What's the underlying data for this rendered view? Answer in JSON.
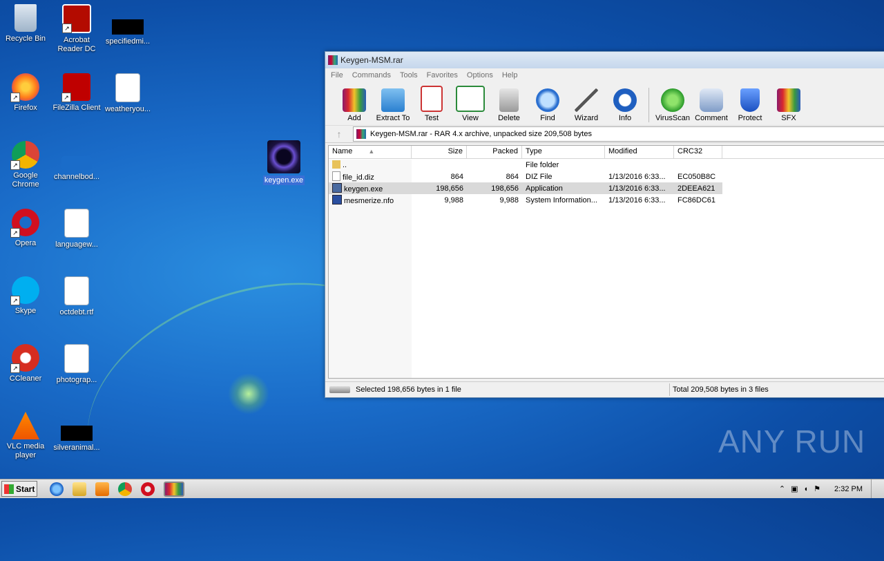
{
  "desktop": {
    "icons": [
      {
        "label": "Recycle Bin",
        "icon": "recycle-bin-icon"
      },
      {
        "label": "Acrobat Reader DC",
        "icon": "acrobat-icon"
      },
      {
        "label": "specifiedmi...",
        "icon": "blacked-file-icon"
      },
      {
        "label": "Firefox",
        "icon": "firefox-icon"
      },
      {
        "label": "FileZilla Client",
        "icon": "filezilla-icon"
      },
      {
        "label": "weatheryou...",
        "icon": "word-doc-icon"
      },
      {
        "label": "Google Chrome",
        "icon": "chrome-icon"
      },
      {
        "label": "channelbod...",
        "icon": "blank-file-icon"
      },
      {
        "label": "Opera",
        "icon": "opera-icon"
      },
      {
        "label": "languagew...",
        "icon": "word-doc-icon"
      },
      {
        "label": "Skype",
        "icon": "skype-icon"
      },
      {
        "label": "octdebt.rtf",
        "icon": "word-doc-icon"
      },
      {
        "label": "CCleaner",
        "icon": "ccleaner-icon"
      },
      {
        "label": "photograp...",
        "icon": "word-doc-icon"
      },
      {
        "label": "VLC media player",
        "icon": "vlc-icon"
      },
      {
        "label": "silveranimal...",
        "icon": "blacked-file-icon"
      }
    ],
    "selected_icon": {
      "label": "keygen.exe"
    }
  },
  "window": {
    "title": "Keygen-MSM.rar",
    "menu": [
      "File",
      "Commands",
      "Tools",
      "Favorites",
      "Options",
      "Help"
    ],
    "toolbar": [
      "Add",
      "Extract To",
      "Test",
      "View",
      "Delete",
      "Find",
      "Wizard",
      "Info",
      "VirusScan",
      "Comment",
      "Protect",
      "SFX"
    ],
    "address": "Keygen-MSM.rar - RAR 4.x archive, unpacked size 209,508 bytes",
    "columns": [
      "Name",
      "Size",
      "Packed",
      "Type",
      "Modified",
      "CRC32"
    ],
    "files": [
      {
        "name": "..",
        "size": "",
        "packed": "",
        "type": "File folder",
        "modified": "",
        "crc": ""
      },
      {
        "name": "file_id.diz",
        "size": "864",
        "packed": "864",
        "type": "DIZ File",
        "modified": "1/13/2016 6:33...",
        "crc": "EC050B8C"
      },
      {
        "name": "keygen.exe",
        "size": "198,656",
        "packed": "198,656",
        "type": "Application",
        "modified": "1/13/2016 6:33...",
        "crc": "2DEEA621"
      },
      {
        "name": "mesmerize.nfo",
        "size": "9,988",
        "packed": "9,988",
        "type": "System Information...",
        "modified": "1/13/2016 6:33...",
        "crc": "FC86DC61"
      }
    ],
    "status_left": "Selected 198,656 bytes in 1 file",
    "status_right": "Total 209,508 bytes in 3 files"
  },
  "taskbar": {
    "start": "Start",
    "clock": "2:32 PM"
  },
  "watermark": "ANY RUN"
}
